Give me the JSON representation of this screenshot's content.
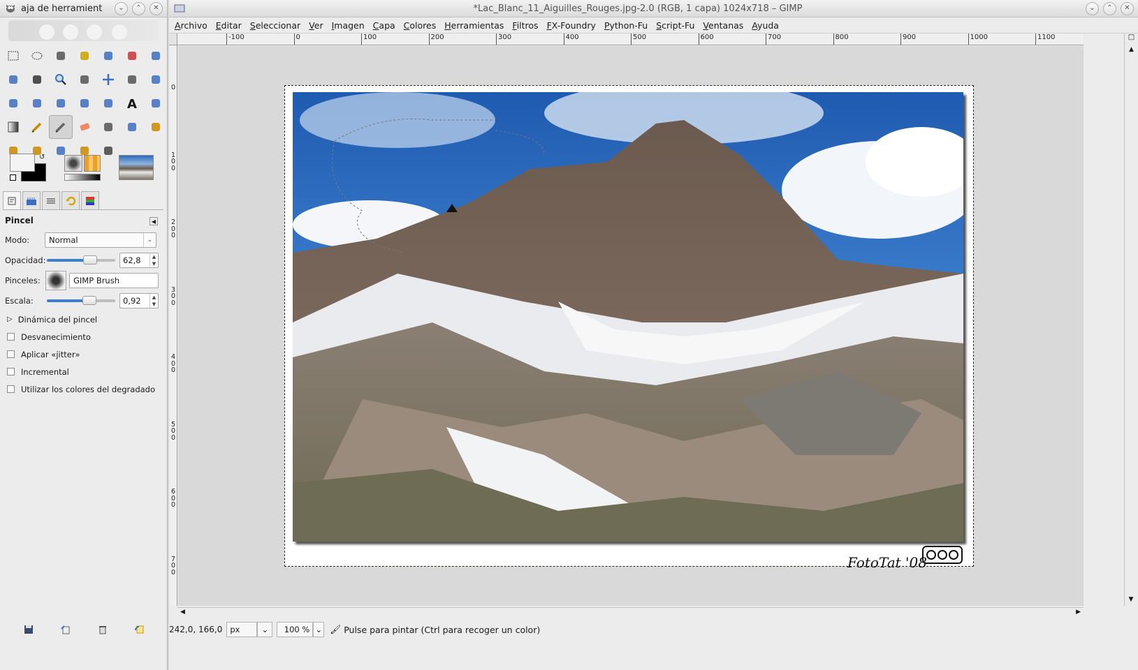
{
  "toolbox": {
    "title": "aja de herramient",
    "tools": [
      "rect-select",
      "ellipse-select",
      "free-select",
      "fuzzy-select",
      "select-by-color",
      "scissors-select",
      "foreground-select",
      "paths",
      "color-picker",
      "zoom",
      "measure",
      "move",
      "align",
      "crop",
      "rotate",
      "scale",
      "shear",
      "perspective",
      "flip",
      "text",
      "bucket-fill",
      "blend",
      "pencil",
      "paintbrush",
      "eraser",
      "airbrush",
      "ink",
      "clone",
      "heal",
      "perspective-clone",
      "blur",
      "smudge",
      "dodge-burn"
    ],
    "tool_options": {
      "title": "Pincel",
      "mode_label": "Modo:",
      "mode_value": "Normal",
      "opacity_label": "Opacidad:",
      "opacity_value": "62,8",
      "opacity_fraction": 0.628,
      "brushes_label": "Pinceles:",
      "brush_name": "GIMP Brush",
      "scale_label": "Escala:",
      "scale_value": "0,92",
      "scale_fraction": 0.62,
      "dynamics_label": "Dinámica del pincel",
      "checkboxes": [
        "Desvanecimiento",
        "Aplicar «jitter»",
        "Incremental",
        "Utilizar los colores del degradado"
      ]
    }
  },
  "image_window": {
    "title": "*Lac_Blanc_11_Aiguilles_Rouges.jpg-2.0 (RGB, 1 capa) 1024x718 – GIMP",
    "menu": [
      "Archivo",
      "Editar",
      "Seleccionar",
      "Ver",
      "Imagen",
      "Capa",
      "Colores",
      "Herramientas",
      "Filtros",
      "FX-Foundry",
      "Python-Fu",
      "Script-Fu",
      "Ventanas",
      "Ayuda"
    ],
    "ruler_h": [
      "-100",
      "0",
      "100",
      "200",
      "300",
      "400",
      "500",
      "600",
      "700",
      "800",
      "900",
      "1000",
      "1100"
    ],
    "ruler_v": [
      "0",
      "100",
      "200",
      "300",
      "400",
      "500",
      "600",
      "700"
    ],
    "signature": "FotoTat '08",
    "status": {
      "coords": "242,0, 166,0",
      "unit": "px",
      "zoom": "100 %",
      "message": "Pulse para pintar (Ctrl para recoger un color)"
    }
  },
  "colors": {
    "accent": "#3c7fd1",
    "selection_dash": "#c9b400"
  }
}
